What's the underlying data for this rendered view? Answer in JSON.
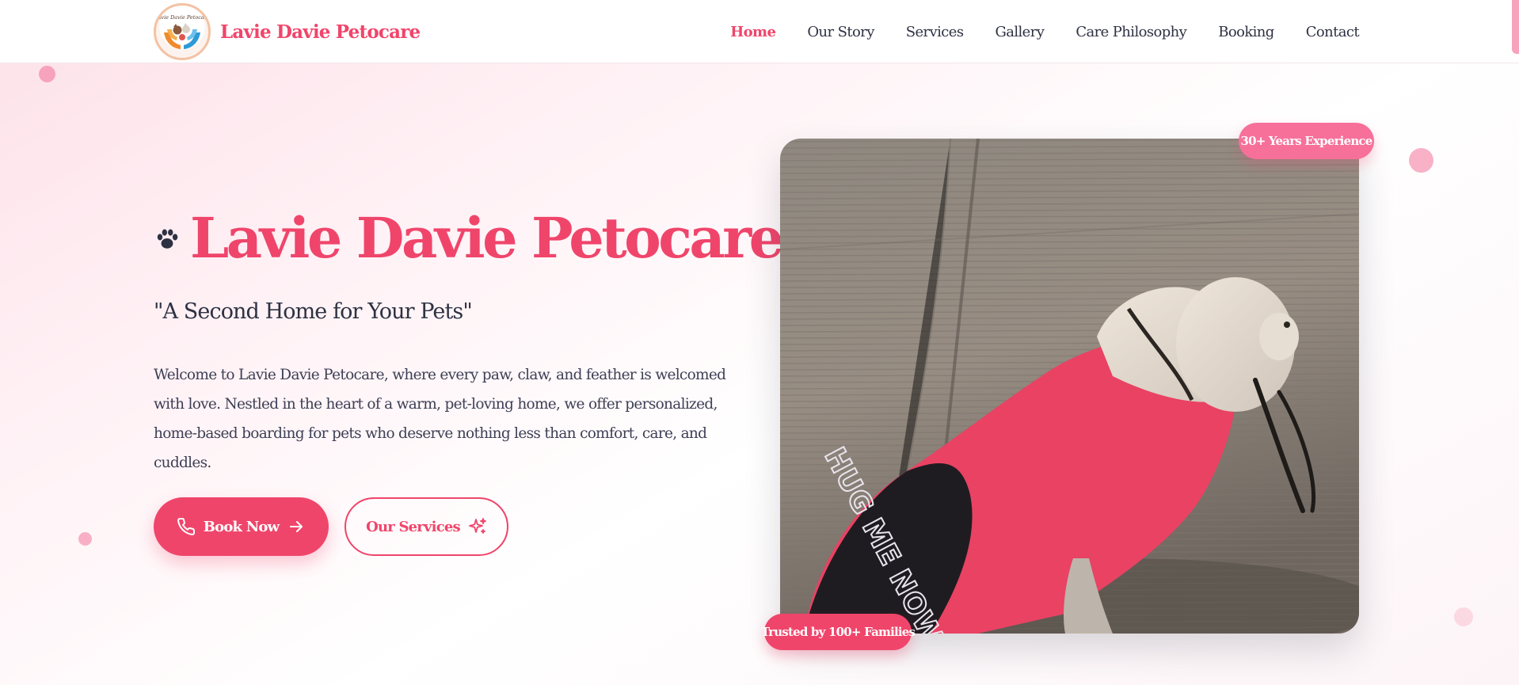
{
  "brand": {
    "name": "Lavie Davie Petocare",
    "logo_text": "Lavie Davie Petocare",
    "logo_icon": "hands-holding-pets-logo"
  },
  "nav": {
    "items": [
      {
        "label": "Home",
        "active": true
      },
      {
        "label": "Our Story",
        "active": false
      },
      {
        "label": "Services",
        "active": false
      },
      {
        "label": "Gallery",
        "active": false
      },
      {
        "label": "Care Philosophy",
        "active": false
      },
      {
        "label": "Booking",
        "active": false
      },
      {
        "label": "Contact",
        "active": false
      }
    ]
  },
  "hero": {
    "title": "Lavie Davie Petocare",
    "title_icon": "paw-icon",
    "tagline": "\"A Second Home for Your Pets\"",
    "intro": "Welcome to Lavie Davie Petocare, where every paw, claw, and feather is welcomed with love. Nestled in the heart of a warm, pet-loving home, we offer personalized, home-based boarding for pets who deserve nothing less than comfort, care, and cuddles.",
    "primary_button": {
      "label": "Book Now",
      "icon_left": "phone-icon",
      "icon_right": "arrow-right-icon"
    },
    "secondary_button": {
      "label": "Our Services",
      "icon": "sparkles-icon"
    },
    "image_alt": "Small white dog in a red HUG ME NOW shirt on a leash",
    "shirt_text": "HUG ME NOW",
    "badges": {
      "experience": "30+ Years Experience",
      "trust": "Trusted by 100+ Families"
    }
  },
  "colors": {
    "accent": "#f0456b",
    "accent_soft": "#f7709a",
    "text_dark": "#2e3142",
    "hero_bg_tint": "#fde3ea"
  }
}
